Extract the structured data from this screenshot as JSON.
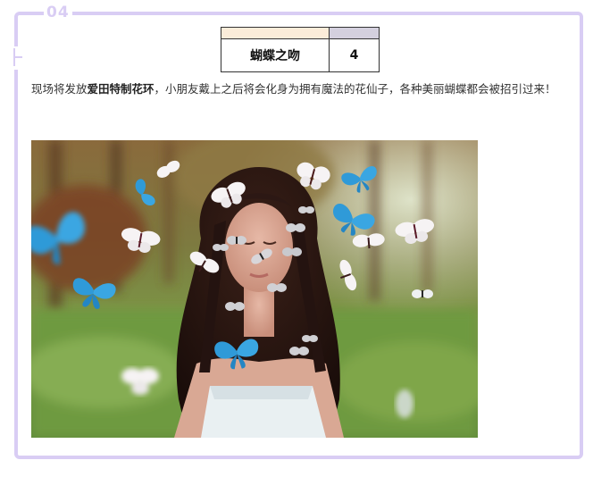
{
  "section": {
    "number": "04"
  },
  "table": {
    "item_name": "蝴蝶之吻",
    "item_value": "4"
  },
  "paragraph": {
    "part1": "现场将发放",
    "highlight": "爱田特制花环",
    "part2": "，小朋友戴上之后将会化身为拥有魔法的花仙子，各种美丽蝴蝶都会被招引过来！"
  },
  "photo": {
    "subject": "woman-with-butterflies-photo"
  },
  "colors": {
    "frame": "#d9cdf4",
    "header_left": "#fbecd9",
    "header_right": "#d4d0de",
    "butterfly_blue": "#2f9ad8"
  }
}
